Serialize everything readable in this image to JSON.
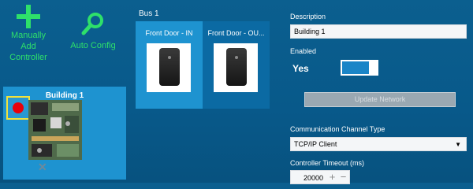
{
  "actions": {
    "manual_add_label": "Manually Add Controller",
    "auto_config_label": "Auto Config"
  },
  "controller": {
    "title": "Building 1",
    "status_color": "#e8000b"
  },
  "bus": {
    "label": "Bus 1",
    "readers": [
      {
        "title": "Front Door - IN",
        "selected": true
      },
      {
        "title": "Front Door - OU...",
        "selected": false
      }
    ]
  },
  "properties": {
    "description_label": "Description",
    "description_value": "Building 1",
    "enabled_label": "Enabled",
    "enabled_value": "Yes",
    "update_network_label": "Update Network",
    "channel_label": "Communication Channel Type",
    "channel_value": "TCP/IP Client",
    "timeout_label": "Controller Timeout (ms)",
    "timeout_value": "20000"
  },
  "icons": {
    "plus": "plus-icon",
    "search": "search-icon",
    "close": "close-icon",
    "chevron": "chevron-down-icon"
  },
  "colors": {
    "accent_green": "#2ee06a",
    "tile_blue": "#1e93d0",
    "status_red": "#e8000b",
    "highlight_yellow": "#f2e23a"
  }
}
